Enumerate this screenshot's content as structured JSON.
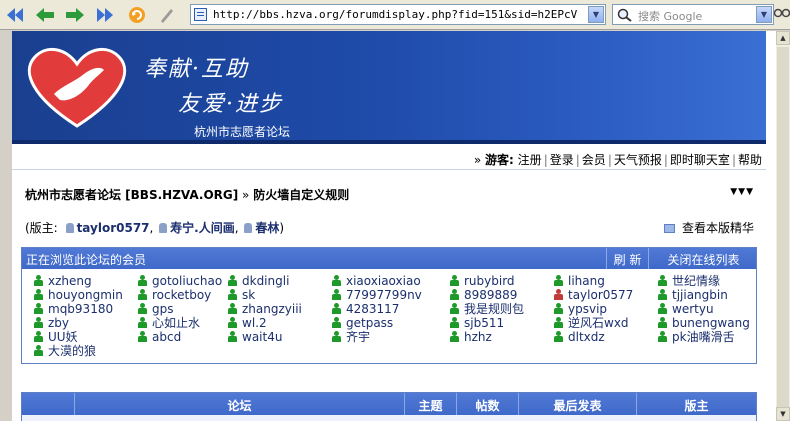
{
  "browser": {
    "url": "http://bbs.hzva.org/forumdisplay.php?fid=151&sid=h2EPcV",
    "search_placeholder": "搜索 Google"
  },
  "banner": {
    "slogan_line1": "奉献·互助",
    "slogan_line2": "友爱·进步",
    "site_name": "杭州市志愿者论坛"
  },
  "topnav": {
    "guest_label": "游客:",
    "items": [
      "注册",
      "登录",
      "会员",
      "天气预报",
      "即时聊天室",
      "帮助"
    ]
  },
  "breadcrumb": {
    "forum_root": "杭州市志愿者论坛 [BBS.HZVA.ORG]",
    "separator": "»",
    "current": "防火墙自定义规则"
  },
  "moderators": {
    "prefix": "(版主:",
    "names": [
      "taylor0577",
      "寿宁.人间画",
      "春林"
    ],
    "suffix": ")",
    "essence_link": "查看本版精华"
  },
  "online": {
    "title": "正在浏览此论坛的会员",
    "refresh_label": "刷 新",
    "close_label": "关闭在线列表",
    "users": [
      {
        "name": "xzheng",
        "color": "green"
      },
      {
        "name": "gotoliuchao",
        "color": "green"
      },
      {
        "name": "dkdingli",
        "color": "green"
      },
      {
        "name": "xiaoxiaoxiao",
        "color": "green"
      },
      {
        "name": "rubybird",
        "color": "green"
      },
      {
        "name": "lihang",
        "color": "green"
      },
      {
        "name": "世纪情缘",
        "color": "green"
      },
      {
        "name": "houyongmin",
        "color": "green"
      },
      {
        "name": "rocketboy",
        "color": "green"
      },
      {
        "name": "sk",
        "color": "green"
      },
      {
        "name": "77997799nv",
        "color": "green"
      },
      {
        "name": "8989889",
        "color": "green"
      },
      {
        "name": "taylor0577",
        "color": "red"
      },
      {
        "name": "tjjiangbin",
        "color": "green"
      },
      {
        "name": "mqb93180",
        "color": "green"
      },
      {
        "name": "gps",
        "color": "green"
      },
      {
        "name": "zhangzyiii",
        "color": "green"
      },
      {
        "name": "4283117",
        "color": "green"
      },
      {
        "name": "我是规则包",
        "color": "green"
      },
      {
        "name": "ypsvip",
        "color": "green"
      },
      {
        "name": "wertyu",
        "color": "green"
      },
      {
        "name": "zby",
        "color": "green"
      },
      {
        "name": "心如止水",
        "color": "green"
      },
      {
        "name": "wl.2",
        "color": "green"
      },
      {
        "name": "getpass",
        "color": "green"
      },
      {
        "name": "sjb511",
        "color": "green"
      },
      {
        "name": "逆风石wxd",
        "color": "green"
      },
      {
        "name": "bunengwang",
        "color": "green"
      },
      {
        "name": "UU妖",
        "color": "green"
      },
      {
        "name": "abcd",
        "color": "green"
      },
      {
        "name": "wait4u",
        "color": "green"
      },
      {
        "name": "齐宇",
        "color": "green"
      },
      {
        "name": "hzhz",
        "color": "green"
      },
      {
        "name": "dltxdz",
        "color": "green"
      },
      {
        "name": "pk油嘴滑舌",
        "color": "green"
      },
      {
        "name": "大漠的狼",
        "color": "green"
      }
    ]
  },
  "forum_table": {
    "columns": [
      "论坛",
      "主题",
      "帖数",
      "最后发表",
      "版主"
    ]
  },
  "colors": {
    "banner_blue": "#1e4aa8",
    "header_blue": "#4a72d3",
    "link_blue": "#1b2f6e",
    "online_green": "#1e9a2a",
    "online_red": "#c23a3a"
  }
}
